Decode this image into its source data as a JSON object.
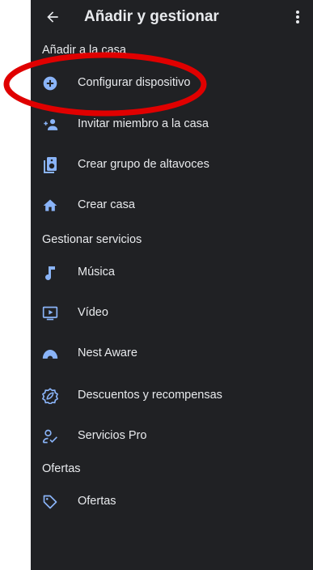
{
  "header": {
    "title": "Añadir y gestionar",
    "back_icon": "arrow-back-icon",
    "more_icon": "more-vert-icon"
  },
  "colors": {
    "background": "#202124",
    "text": "#e8eaed",
    "icon_accent": "#8ab4f8",
    "annotation": "#e00000"
  },
  "sections": [
    {
      "header": "Añadir a la casa",
      "items": [
        {
          "label": "Configurar dispositivo",
          "icon": "add-circle-icon"
        },
        {
          "label": "Invitar miembro a la casa",
          "icon": "person-add-icon"
        },
        {
          "label": "Crear grupo de altavoces",
          "icon": "speaker-group-icon"
        },
        {
          "label": "Crear casa",
          "icon": "home-icon"
        }
      ]
    },
    {
      "header": "Gestionar servicios",
      "items": [
        {
          "label": "Música",
          "icon": "music-note-icon"
        },
        {
          "label": "Vídeo",
          "icon": "video-icon"
        },
        {
          "label": "Nest Aware",
          "icon": "nest-aware-icon"
        },
        {
          "label": "Descuentos y recompensas",
          "icon": "rewards-icon"
        },
        {
          "label": "Servicios Pro",
          "icon": "pro-services-icon"
        }
      ]
    },
    {
      "header": "Ofertas",
      "items": [
        {
          "label": "Ofertas",
          "icon": "tag-icon"
        }
      ]
    }
  ]
}
